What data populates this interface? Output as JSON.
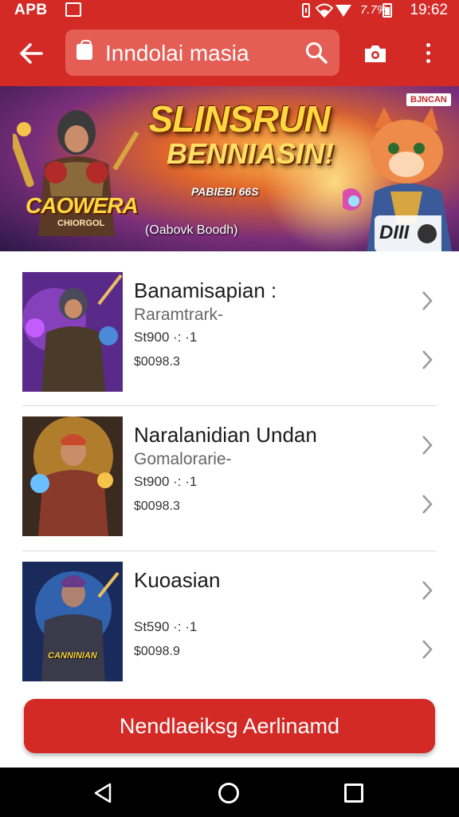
{
  "status_bar": {
    "left_text": "APB",
    "battery_percent": "7.7%",
    "time": "19:62",
    "icons": [
      "image-icon",
      "vibrate-icon",
      "wifi-icon",
      "signal-icon",
      "battery-icon"
    ]
  },
  "toolbar": {
    "search_value": "Inndolai masia",
    "icons": [
      "back-arrow-icon",
      "shopping-bag-icon",
      "search-icon",
      "camera-icon",
      "more-vert-icon"
    ]
  },
  "banner": {
    "title": "SLINSRUN",
    "subtitle": "BENNIASIN!",
    "tagline": "PABIEBI 66S",
    "logo_text": "CAOWERA",
    "logo_subtext": "CHIORGOL",
    "caption": "(Oabovk Boodh)",
    "badge": "BJNCAN",
    "play_label": "DIII"
  },
  "items": [
    {
      "title": "Banamisapian :",
      "subtitle": "Raramtrark-",
      "price1": "St900 ·: ·1",
      "price2": "$0098.3"
    },
    {
      "title": "Naralanidian Undan",
      "subtitle": "Gomalorarie-",
      "price1": "St900 ·: ·1",
      "price2": "$0098.3"
    },
    {
      "title": "Kuoasian",
      "subtitle": "",
      "price1": "St590 ·: ·1",
      "price2": "$0098.9"
    }
  ],
  "thumb_texts": [
    "",
    "",
    "CANNINIAN"
  ],
  "primary_button": "Nendlaeiksg Aerlinamd",
  "colors": {
    "accent": "#d32a26",
    "search_box": "#e55e55",
    "nav_bar": "#000000"
  }
}
